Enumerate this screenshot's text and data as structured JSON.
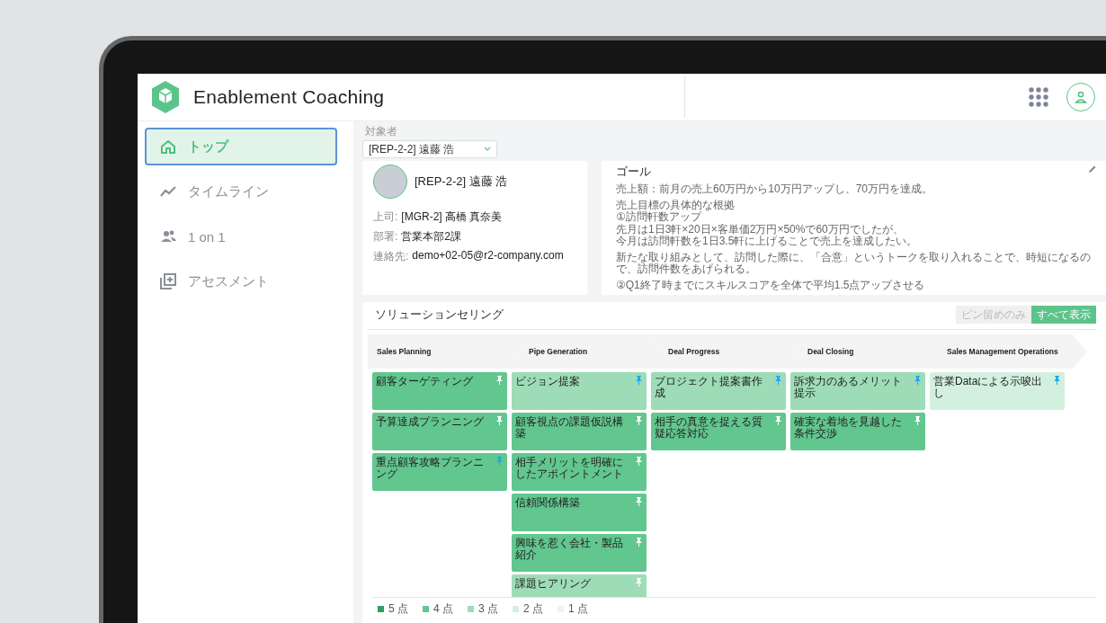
{
  "app": {
    "title": "Enablement Coaching"
  },
  "sidebar": {
    "items": [
      {
        "label": "トップ",
        "selected": true
      },
      {
        "label": "タイムライン",
        "selected": false
      },
      {
        "label": "1 on 1",
        "selected": false
      },
      {
        "label": "アセスメント",
        "selected": false
      }
    ]
  },
  "target_select": {
    "label": "対象者",
    "value": "[REP-2-2] 遠藤 浩"
  },
  "profile": {
    "name": "[REP-2-2] 遠藤 浩",
    "fields": [
      {
        "label": "上司:",
        "value": "[MGR-2] 高橋 真奈美"
      },
      {
        "label": "部署:",
        "value": "営業本部2課"
      },
      {
        "label": "連絡先:",
        "value": "demo+02-05@r2-company.com"
      }
    ]
  },
  "goal": {
    "title": "ゴール",
    "paragraphs": [
      [
        "売上額：前月の売上60万円から10万円アップし、70万円を達成。"
      ],
      [
        "売上目標の具体的な根拠",
        "①訪問軒数アップ",
        "先月は1日3軒×20日×客単価2万円×50%で60万円でしたが、",
        "今月は訪問軒数を1日3.5軒に上げることで売上を達成したい。"
      ],
      [
        "新たな取り組みとして、訪問した際に、「合意」というトークを取り入れることで、時短になるので、訪問件数をあげられる。"
      ],
      [
        "②Q1終了時までにスキルスコアを全体で平均1.5点アップさせる"
      ]
    ]
  },
  "skills": {
    "title": "ソリューションセリング",
    "filters": [
      {
        "label": "ピン留めのみ",
        "selected": false
      },
      {
        "label": "すべて表示",
        "selected": true
      }
    ],
    "stages": [
      {
        "name": "Sales Planning",
        "cards": [
          {
            "label": "顧客ターゲティング",
            "color": "#62c68f",
            "pinned": false
          },
          {
            "label": "予算達成プランニング",
            "color": "#62c68f",
            "pinned": false
          },
          {
            "label": "重点顧客攻略プランニング",
            "color": "#62c68f",
            "pinned": true
          }
        ]
      },
      {
        "name": "Pipe Generation",
        "cards": [
          {
            "label": "ビジョン提案",
            "color": "#9ddcb7",
            "pinned": true
          },
          {
            "label": "顧客視点の課題仮説構築",
            "color": "#62c68f",
            "pinned": false
          },
          {
            "label": "相手メリットを明確にしたアポイントメント",
            "color": "#62c68f",
            "pinned": false
          },
          {
            "label": "信頼関係構築",
            "color": "#62c68f",
            "pinned": false
          },
          {
            "label": "興味を惹く会社・製品紹介",
            "color": "#62c68f",
            "pinned": false
          },
          {
            "label": "課題ヒアリング",
            "color": "#9ddcb7",
            "pinned": false
          }
        ]
      },
      {
        "name": "Deal Progress",
        "cards": [
          {
            "label": "プロジェクト提案書作成",
            "color": "#9ddcb7",
            "pinned": true
          },
          {
            "label": "相手の真意を捉える質疑応答対応",
            "color": "#62c68f",
            "pinned": false
          }
        ]
      },
      {
        "name": "Deal Closing",
        "cards": [
          {
            "label": "訴求力のあるメリット提示",
            "color": "#9ddcb7",
            "pinned": true
          },
          {
            "label": "確実な着地を見越した条件交渉",
            "color": "#62c68f",
            "pinned": false
          }
        ]
      },
      {
        "name": "Sales Management Operations",
        "cards": [
          {
            "label": "営業Dataによる示唆出し",
            "color": "#d3f0df",
            "pinned": true
          }
        ]
      }
    ],
    "legend": [
      {
        "label": "5 点",
        "color": "#2e9e62"
      },
      {
        "label": "4 点",
        "color": "#62c68f"
      },
      {
        "label": "3 点",
        "color": "#9ddcb7"
      },
      {
        "label": "2 点",
        "color": "#d3f0df"
      },
      {
        "label": "1 点",
        "color": "#e8f6ee"
      }
    ]
  }
}
